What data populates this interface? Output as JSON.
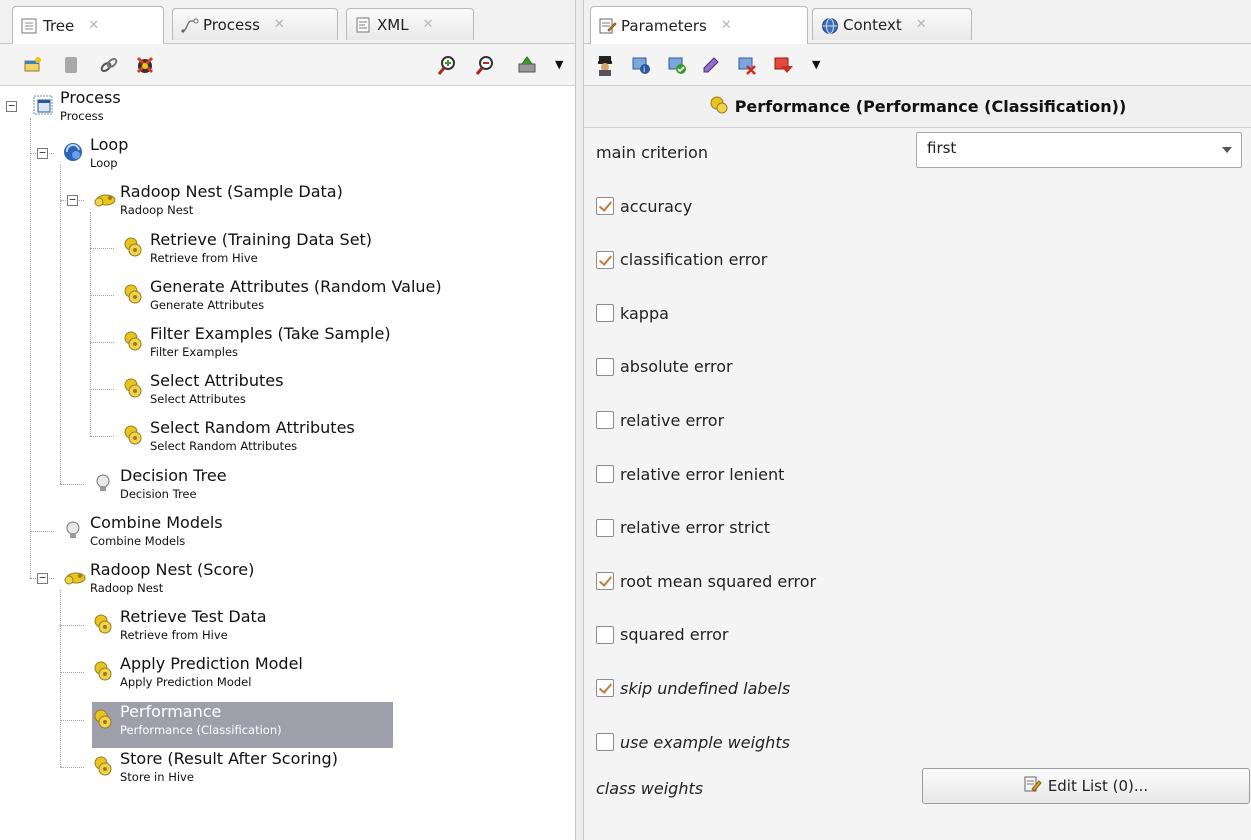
{
  "left_tabs": [
    {
      "label": "Tree"
    },
    {
      "label": "Process"
    },
    {
      "label": "XML"
    }
  ],
  "right_tabs": [
    {
      "label": "Parameters"
    },
    {
      "label": "Context"
    }
  ],
  "tree": {
    "nodes": [
      {
        "title": "Process",
        "subtitle": "Process"
      },
      {
        "title": "Loop",
        "subtitle": "Loop"
      },
      {
        "title": "Radoop Nest (Sample Data)",
        "subtitle": "Radoop Nest"
      },
      {
        "title": "Retrieve (Training Data Set)",
        "subtitle": "Retrieve from Hive"
      },
      {
        "title": "Generate Attributes (Random Value)",
        "subtitle": "Generate Attributes"
      },
      {
        "title": "Filter Examples (Take Sample)",
        "subtitle": "Filter Examples"
      },
      {
        "title": "Select Attributes",
        "subtitle": "Select Attributes"
      },
      {
        "title": "Select Random Attributes",
        "subtitle": "Select Random Attributes"
      },
      {
        "title": "Decision Tree",
        "subtitle": "Decision Tree"
      },
      {
        "title": "Combine Models",
        "subtitle": "Combine Models"
      },
      {
        "title": "Radoop Nest (Score)",
        "subtitle": "Radoop Nest"
      },
      {
        "title": "Retrieve Test Data",
        "subtitle": "Retrieve from Hive"
      },
      {
        "title": "Apply Prediction Model",
        "subtitle": "Apply Prediction Model"
      },
      {
        "title": "Performance",
        "subtitle": "Performance (Classification)",
        "selected": true
      },
      {
        "title": "Store (Result After Scoring)",
        "subtitle": "Store in Hive"
      }
    ]
  },
  "params": {
    "header": "Performance (Performance (Classification))",
    "main_criterion": {
      "label": "main criterion",
      "value": "first"
    },
    "checkboxes": [
      {
        "label": "accuracy",
        "checked": true
      },
      {
        "label": "classification error",
        "checked": true
      },
      {
        "label": "kappa",
        "checked": false
      },
      {
        "label": "absolute error",
        "checked": false
      },
      {
        "label": "relative error",
        "checked": false
      },
      {
        "label": "relative error lenient",
        "checked": false
      },
      {
        "label": "relative error strict",
        "checked": false
      },
      {
        "label": "root mean squared error",
        "checked": true
      },
      {
        "label": "squared error",
        "checked": false
      },
      {
        "label": "skip undefined labels",
        "checked": true
      },
      {
        "label": "use example weights",
        "checked": false
      }
    ],
    "class_weights": {
      "label": "class weights",
      "button": "Edit List (0)..."
    }
  },
  "colors": {
    "selection": "#9f9fab",
    "check": "#c9773c",
    "operator_yellow": "#e8c51c"
  }
}
